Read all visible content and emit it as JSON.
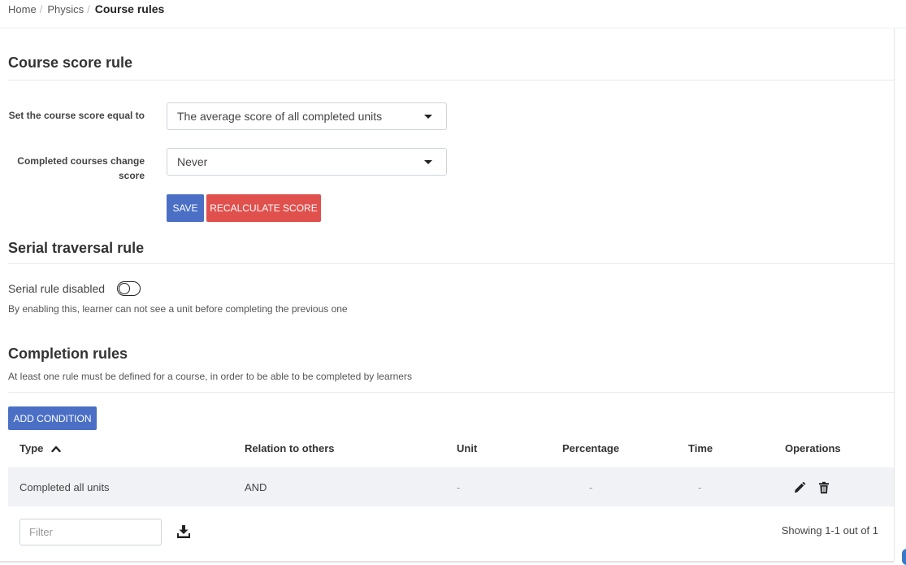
{
  "breadcrumb": {
    "items": [
      "Home",
      "Physics"
    ],
    "separator": "/",
    "current": "Course rules"
  },
  "score_rule": {
    "title": "Course score rule",
    "equal_label": "Set the course score equal to",
    "equal_value": "The average score of all completed units",
    "change_label": "Completed courses change score",
    "change_value": "Never",
    "save_label": "SAVE",
    "recalc_label": "RECALCULATE SCORE"
  },
  "serial_rule": {
    "title": "Serial traversal rule",
    "toggle_label": "Serial rule disabled",
    "toggle_on": false,
    "help": "By enabling this, learner can not see a unit before completing the previous one"
  },
  "completion": {
    "title": "Completion rules",
    "help": "At least one rule must be defined for a course, in order to be able to be completed by learners",
    "add_label": "ADD CONDITION",
    "columns": [
      "Type",
      "Relation to others",
      "Unit",
      "Percentage",
      "Time",
      "Operations"
    ],
    "sort_column": "Type",
    "sort_direction": "ascending",
    "rows": [
      {
        "type": "Completed all units",
        "relation": "AND",
        "unit": "-",
        "percentage": "-",
        "time": "-"
      }
    ],
    "filter_placeholder": "Filter",
    "showing": "Showing 1-1 out of 1"
  },
  "icons": {
    "sort": "chevron-up-icon",
    "edit": "pencil-icon",
    "delete": "trash-icon",
    "export": "download-icon"
  },
  "colors": {
    "primary": "#4a6fc5",
    "danger": "#e0504d",
    "row_bg": "#f0f2f5"
  }
}
